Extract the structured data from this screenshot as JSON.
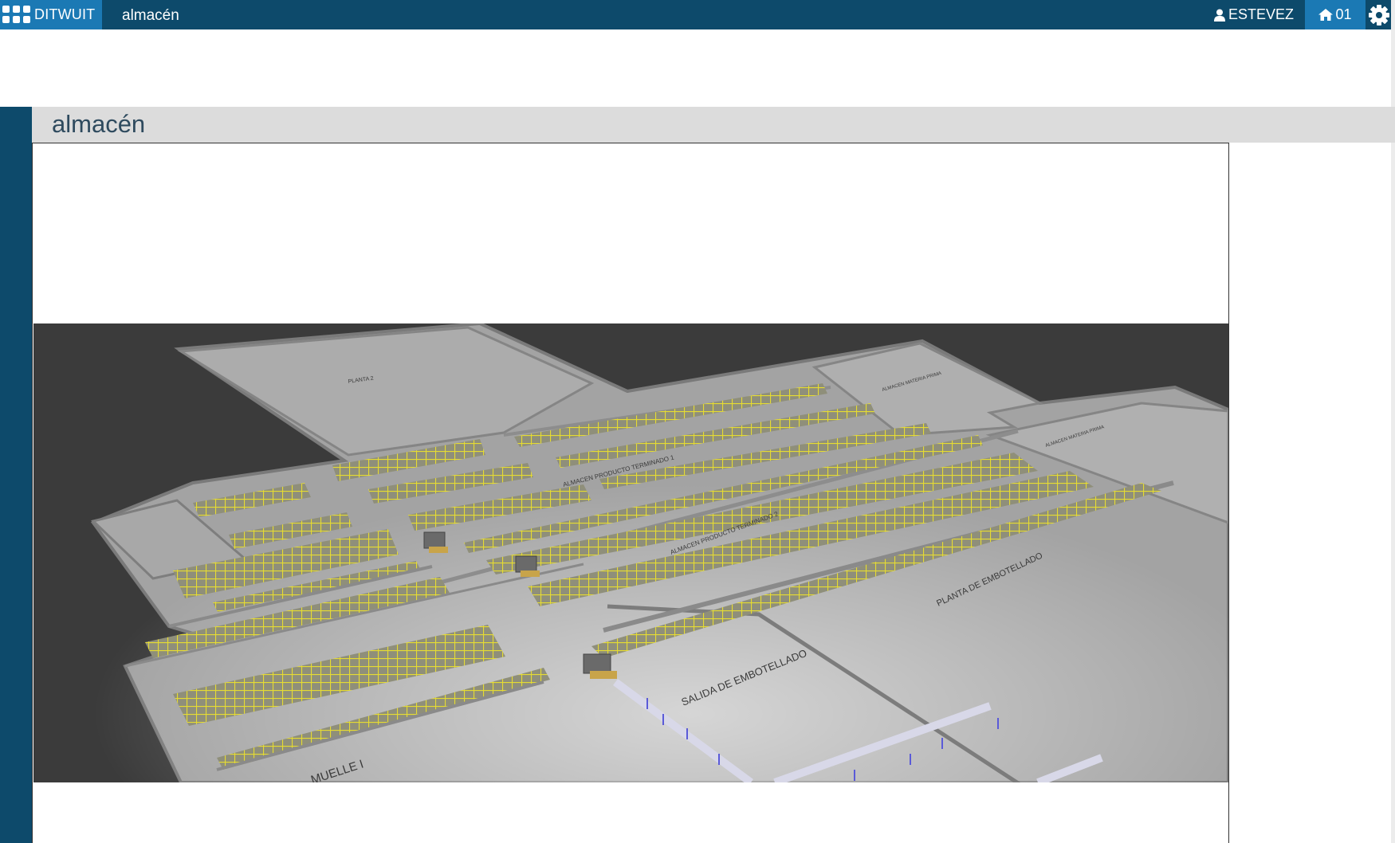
{
  "app": {
    "brand": "DITWUIT",
    "breadcrumb": "almacén",
    "user": "ESTEVEZ",
    "home_label": "01"
  },
  "page": {
    "title": "almacén"
  },
  "scene": {
    "labels": {
      "top_area": "PLANTA 2",
      "store_1": "ALMACEN PRODUCTO TERMINADO 1",
      "store_2": "ALMACEN PRODUCTO TERMINADO 2",
      "bottling_plant": "PLANTA DE EMBOTELLADO",
      "bottling_exit": "SALIDA DE EMBOTELLADO",
      "dock": "MUELLE I",
      "raw_1": "ALMACEN MATERIA PRIMA",
      "raw_2": "ALMACEN MATERIA PRIMA"
    },
    "colors": {
      "background": "#3b3b3b",
      "floor": "#a3a3a3",
      "rack": "#e6dc32",
      "conveyor": "#5a5ad8"
    }
  }
}
